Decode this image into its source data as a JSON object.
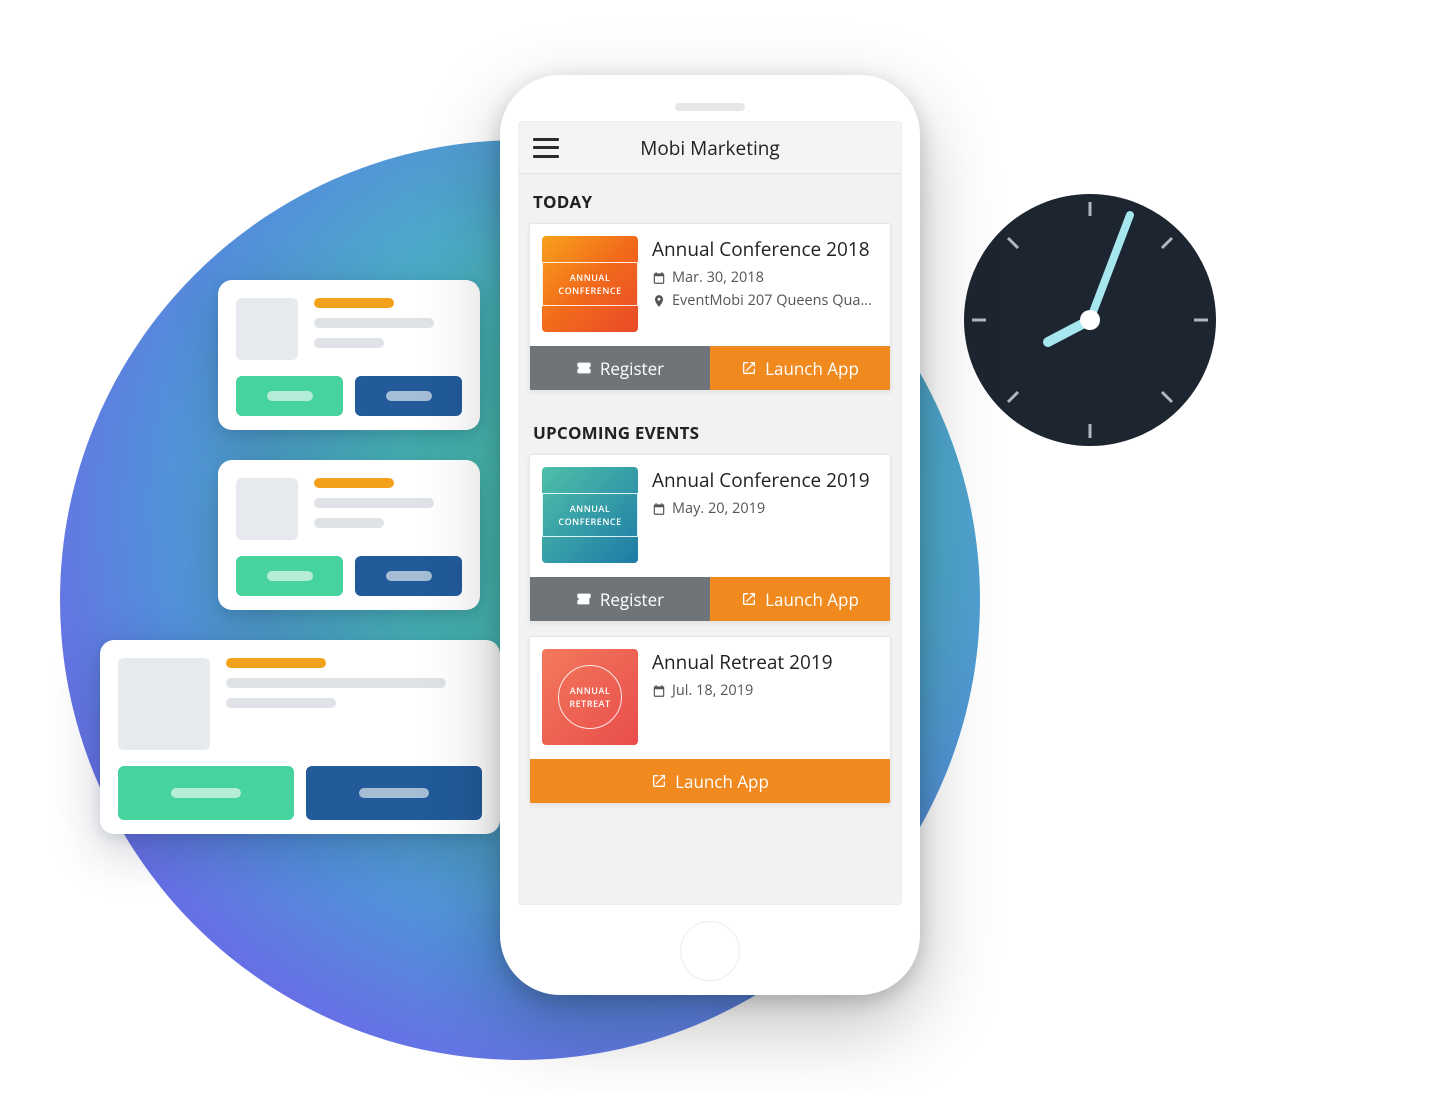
{
  "header": {
    "title": "Mobi Marketing"
  },
  "sections": {
    "today": "TODAY",
    "upcoming": "UPCOMING EVENTS"
  },
  "buttons": {
    "register": "Register",
    "launch": "Launch App"
  },
  "events": {
    "today": {
      "title": "Annual Conference 2018",
      "thumb_label": "ANNUAL CONFERENCE",
      "date": "Mar. 30, 2018",
      "location": "EventMobi 207 Queens Qua..."
    },
    "upcoming": [
      {
        "title": "Annual Conference 2019",
        "thumb_label": "ANNUAL CONFERENCE",
        "date": "May. 20, 2019"
      },
      {
        "title": "Annual Retreat 2019",
        "thumb_label": "ANNUAL RETREAT",
        "date": "Jul. 18, 2019"
      }
    ]
  }
}
